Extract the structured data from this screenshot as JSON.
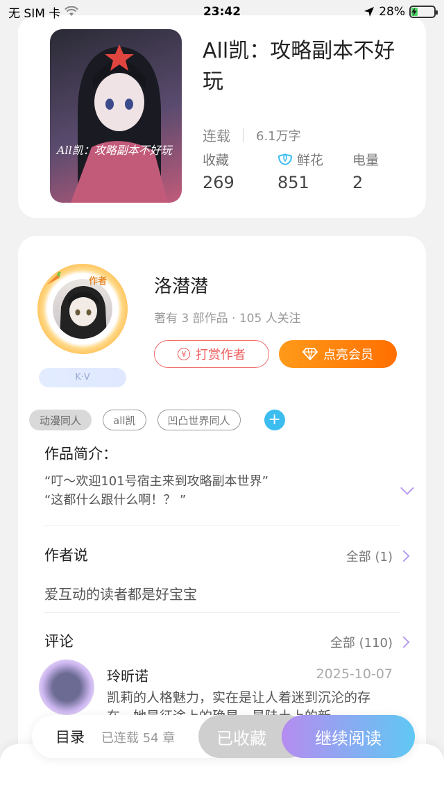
{
  "status_bar": {
    "carrier": "无 SIM 卡",
    "time": "23:42",
    "battery_percent": "28%",
    "battery_level": 0.28
  },
  "book": {
    "title": "All凯：攻略副本不好玩",
    "status": "连载",
    "word_count": "6.1万字",
    "cover_text": "All凯：攻略副本不好玩",
    "stats": [
      {
        "label": "收藏",
        "value": "269"
      },
      {
        "label": "鲜花",
        "value": "851",
        "icon": "flower-icon"
      },
      {
        "label": "电量",
        "value": "2"
      }
    ]
  },
  "author": {
    "badge": "作者",
    "name": "洛潜潜",
    "summary": "著有 3 部作品 · 105 人关注",
    "kv_label": "K·V",
    "reward_button": "打赏作者",
    "vip_button": "点亮会员"
  },
  "tags": [
    {
      "label": "动漫同人",
      "filled": true
    },
    {
      "label": "all凯",
      "filled": false
    },
    {
      "label": "凹凸世界同人",
      "filled": false
    }
  ],
  "intro": {
    "title": "作品简介：",
    "line1": "“叮～欢迎101号宿主来到攻略副本世界”",
    "line2": "“这都什么跟什么啊！？ ”"
  },
  "author_says": {
    "title": "作者说",
    "all_label": "全部 (1)",
    "text": "爱互动的读者都是好宝宝"
  },
  "comments": {
    "title": "评论",
    "all_label": "全部 (110)",
    "items": [
      {
        "user": "玲昕诺",
        "date": "2025-10-07",
        "text": "凯莉的人格魅力，实在是让人着迷到沉沦的存在，她是征途上的确星，是陆土上的新"
      }
    ]
  },
  "bottom_bar": {
    "toc_label": "目录",
    "chapters_label": "已连载 54 章",
    "collected_label": "已收藏",
    "read_label": "继续阅读"
  },
  "colors": {
    "accent_purple": "#b58cf0",
    "accent_blue": "#5fc8f3",
    "vip_orange": "#ff7a00",
    "reward_red": "#ee5b5b"
  }
}
